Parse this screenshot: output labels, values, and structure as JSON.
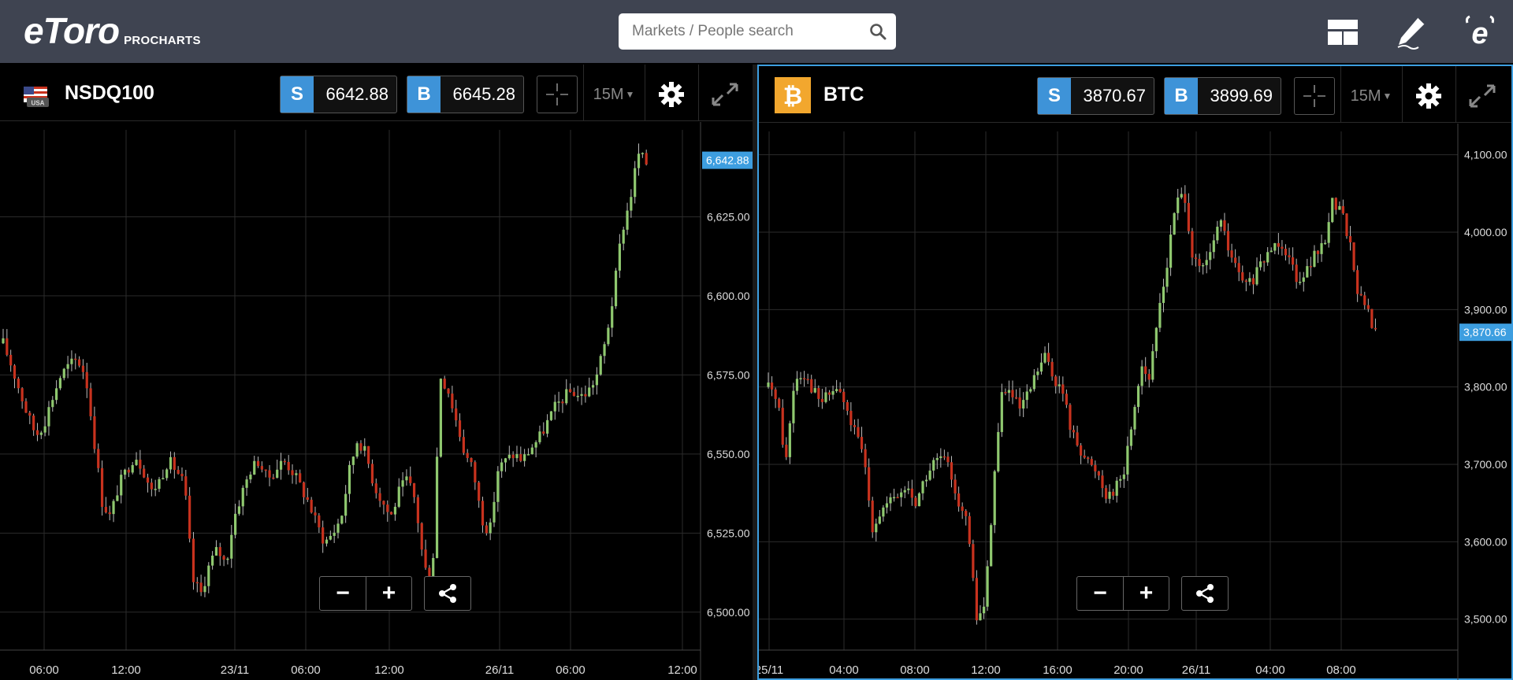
{
  "app": {
    "logo_text": "eToro",
    "logo_sub": "PROCHARTS",
    "search_placeholder": "Markets / People search"
  },
  "colors": {
    "topbar": "#3f4451",
    "buy_sell_tag": "#3e93d8",
    "up_candle": "#8fc86f",
    "down_candle": "#c8321e",
    "price_label": "#3d9ee0",
    "btc_icon": "#f2a72e",
    "grid": "#2b2b2b"
  },
  "icons": [
    "layout-icon",
    "pencil-icon",
    "etoro-e-icon",
    "search-icon",
    "us-flag-icon",
    "bitcoin-icon",
    "crosshair-icon",
    "gear-icon",
    "expand-icon",
    "minus-icon",
    "plus-icon",
    "share-icon"
  ],
  "panels": [
    {
      "instrument": "NSDQ100",
      "flag_label": "USA",
      "sell_label": "S",
      "sell_price": "6642.88",
      "buy_label": "B",
      "buy_price": "6645.28",
      "interval": "15M",
      "zoom_out": "−",
      "zoom_in": "+",
      "current_price_label": "6,642.88",
      "chart_data": {
        "type": "candlestick",
        "y_ticks": [
          "6,625.00",
          "6,600.00",
          "6,575.00",
          "6,550.00",
          "6,525.00",
          "6,500.00"
        ],
        "y_tick_values": [
          6625,
          6600,
          6575,
          6550,
          6525,
          6500
        ],
        "ylim": [
          6488,
          6650
        ],
        "x_ticks": [
          "06:00",
          "12:00",
          "23/11",
          "06:00",
          "12:00",
          "26/11",
          "06:00",
          "12:00"
        ],
        "current_price": 6642.88,
        "close_path": [
          6585,
          6578,
          6570,
          6562,
          6556,
          6560,
          6568,
          6575,
          6578,
          6580,
          6575,
          6555,
          6535,
          6530,
          6540,
          6545,
          6550,
          6545,
          6538,
          6542,
          6548,
          6545,
          6540,
          6510,
          6506,
          6515,
          6520,
          6515,
          6530,
          6538,
          6545,
          6548,
          6542,
          6545,
          6548,
          6545,
          6540,
          6535,
          6528,
          6522,
          6525,
          6530,
          6545,
          6555,
          6550,
          6540,
          6535,
          6530,
          6538,
          6542,
          6535,
          6515,
          6508,
          6575,
          6570,
          6560,
          6550,
          6545,
          6530,
          6525,
          6545,
          6548,
          6550,
          6548,
          6552,
          6555,
          6560,
          6565,
          6568,
          6570,
          6568,
          6570,
          6575,
          6585,
          6600,
          6620,
          6630,
          6645,
          6642
        ]
      }
    },
    {
      "instrument": "BTC",
      "sell_label": "S",
      "sell_price": "3870.67",
      "buy_label": "B",
      "buy_price": "3899.69",
      "interval": "15M",
      "zoom_out": "−",
      "zoom_in": "+",
      "current_price_label": "3,870.66",
      "chart_data": {
        "type": "candlestick",
        "y_ticks": [
          "4,100.00",
          "4,000.00",
          "3,900.00",
          "3,800.00",
          "3,700.00",
          "3,600.00",
          "3,500.00"
        ],
        "y_tick_values": [
          4100,
          4000,
          3900,
          3800,
          3700,
          3600,
          3500
        ],
        "ylim": [
          3460,
          4120
        ],
        "x_ticks": [
          "25/11",
          "04:00",
          "08:00",
          "12:00",
          "16:00",
          "20:00",
          "26/11",
          "04:00",
          "08:00"
        ],
        "current_price": 3870.66,
        "close_path": [
          3800,
          3790,
          3700,
          3810,
          3820,
          3800,
          3780,
          3790,
          3800,
          3770,
          3740,
          3710,
          3620,
          3640,
          3650,
          3660,
          3670,
          3650,
          3680,
          3700,
          3710,
          3690,
          3650,
          3620,
          3500,
          3520,
          3680,
          3800,
          3790,
          3770,
          3790,
          3820,
          3840,
          3810,
          3790,
          3740,
          3720,
          3700,
          3690,
          3660,
          3670,
          3690,
          3760,
          3830,
          3810,
          3900,
          3960,
          4040,
          4050,
          3960,
          3950,
          3970,
          4020,
          3980,
          3950,
          3930,
          3940,
          3960,
          3980,
          3990,
          3970,
          3940,
          3950,
          3970,
          3980,
          4040,
          4030,
          3990,
          3920,
          3900,
          3870
        ]
      }
    }
  ]
}
